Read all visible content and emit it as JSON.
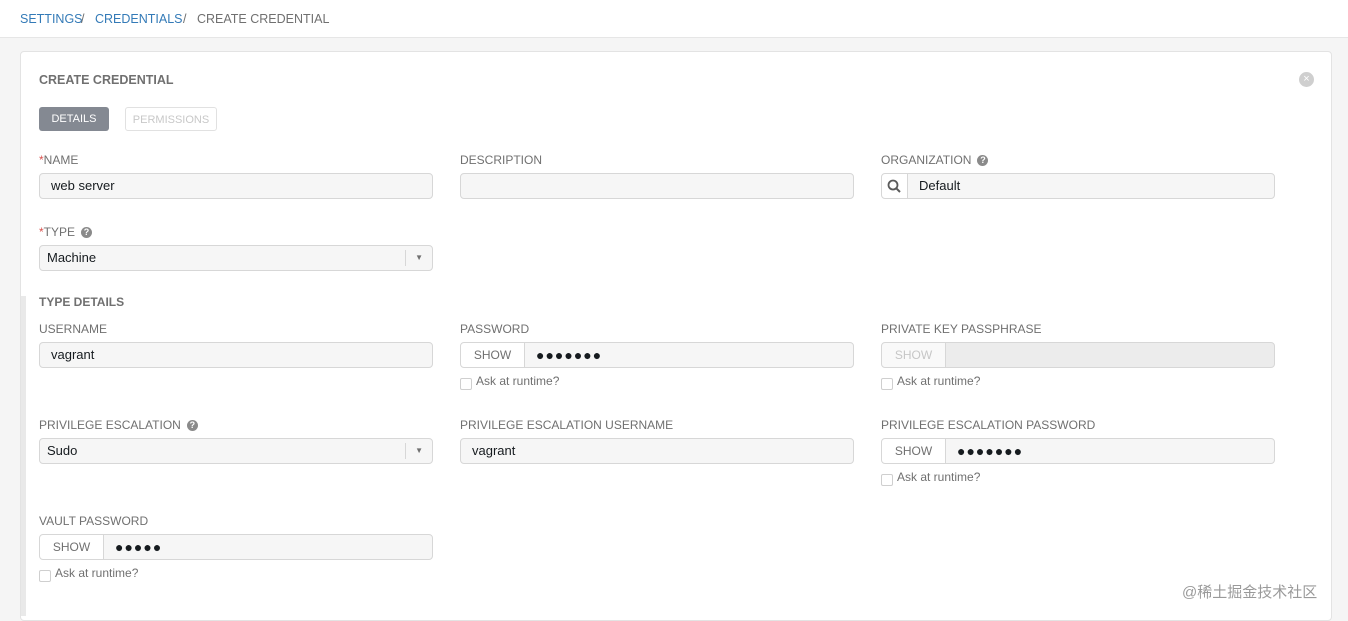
{
  "breadcrumb": {
    "settings": "SETTINGS",
    "credentials": "CREDENTIALS",
    "current": "CREATE CREDENTIAL",
    "separator": "/"
  },
  "form": {
    "title": "CREATE CREDENTIAL",
    "close_icon": "×",
    "tabs": [
      {
        "label": "DETAILS",
        "active": true
      },
      {
        "label": "PERMISSIONS",
        "active": false
      }
    ],
    "required_marker": "*",
    "name": {
      "label": "NAME",
      "value": "web server"
    },
    "description": {
      "label": "DESCRIPTION",
      "value": ""
    },
    "organization": {
      "label": "ORGANIZATION",
      "value": "Default"
    },
    "type": {
      "label": "TYPE",
      "value": "Machine"
    },
    "type_details_title": "TYPE DETAILS",
    "username": {
      "label": "USERNAME",
      "value": "vagrant"
    },
    "password": {
      "label": "PASSWORD",
      "show": "SHOW",
      "value": "●●●●●●●",
      "ask_runtime": "Ask at runtime?"
    },
    "private_key_passphrase": {
      "label": "PRIVATE KEY PASSPHRASE",
      "show": "SHOW",
      "value": "",
      "ask_runtime": "Ask at runtime?"
    },
    "privilege_escalation": {
      "label": "PRIVILEGE ESCALATION",
      "value": "Sudo"
    },
    "privilege_escalation_username": {
      "label": "PRIVILEGE ESCALATION USERNAME",
      "value": "vagrant"
    },
    "privilege_escalation_password": {
      "label": "PRIVILEGE ESCALATION PASSWORD",
      "show": "SHOW",
      "value": "●●●●●●●",
      "ask_runtime": "Ask at runtime?"
    },
    "vault_password": {
      "label": "VAULT PASSWORD",
      "show": "SHOW",
      "value": "●●●●●",
      "ask_runtime": "Ask at runtime?"
    }
  },
  "icons": {
    "help": "?",
    "caret": "▼",
    "search": "search-icon"
  },
  "watermark": "@稀土掘金技术社区",
  "colors": {
    "accent": "#848992",
    "required": "#d9534f",
    "link": "#337ab7"
  }
}
